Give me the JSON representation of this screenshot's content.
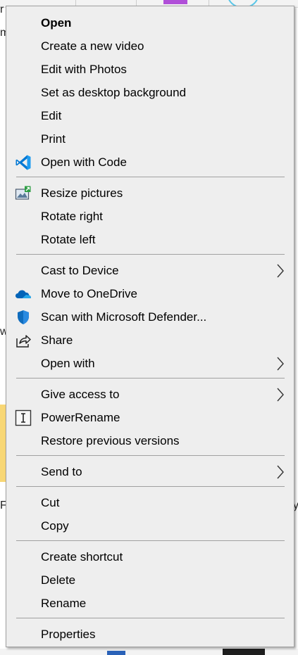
{
  "background": {
    "left_fragments": [
      "r",
      "m",
      "w",
      "F"
    ],
    "right_fragments": [
      "y."
    ]
  },
  "context_menu": {
    "items": [
      {
        "id": "open",
        "label": "Open",
        "icon": "",
        "bold": true,
        "submenu": false
      },
      {
        "id": "create-video",
        "label": "Create a new video",
        "icon": "",
        "bold": false,
        "submenu": false
      },
      {
        "id": "edit-photos",
        "label": "Edit with Photos",
        "icon": "",
        "bold": false,
        "submenu": false
      },
      {
        "id": "set-background",
        "label": "Set as desktop background",
        "icon": "",
        "bold": false,
        "submenu": false
      },
      {
        "id": "edit",
        "label": "Edit",
        "icon": "",
        "bold": false,
        "submenu": false
      },
      {
        "id": "print",
        "label": "Print",
        "icon": "",
        "bold": false,
        "submenu": false
      },
      {
        "id": "open-code",
        "label": "Open with Code",
        "icon": "vscode-icon",
        "bold": false,
        "submenu": false
      },
      {
        "id": "resize-pictures",
        "label": "Resize pictures",
        "icon": "image-resizer-icon",
        "bold": false,
        "submenu": false
      },
      {
        "id": "rotate-right",
        "label": "Rotate right",
        "icon": "",
        "bold": false,
        "submenu": false
      },
      {
        "id": "rotate-left",
        "label": "Rotate left",
        "icon": "",
        "bold": false,
        "submenu": false
      },
      {
        "id": "cast-device",
        "label": "Cast to Device",
        "icon": "",
        "bold": false,
        "submenu": true
      },
      {
        "id": "move-onedrive",
        "label": "Move to OneDrive",
        "icon": "onedrive-cloud-icon",
        "bold": false,
        "submenu": false
      },
      {
        "id": "scan-defender",
        "label": "Scan with Microsoft Defender...",
        "icon": "defender-shield-icon",
        "bold": false,
        "submenu": false
      },
      {
        "id": "share",
        "label": "Share",
        "icon": "share-icon",
        "bold": false,
        "submenu": false
      },
      {
        "id": "open-with",
        "label": "Open with",
        "icon": "",
        "bold": false,
        "submenu": true
      },
      {
        "id": "give-access",
        "label": "Give access to",
        "icon": "",
        "bold": false,
        "submenu": true
      },
      {
        "id": "power-rename",
        "label": "PowerRename",
        "icon": "powerrename-icon",
        "bold": false,
        "submenu": false
      },
      {
        "id": "restore-versions",
        "label": "Restore previous versions",
        "icon": "",
        "bold": false,
        "submenu": false
      },
      {
        "id": "send-to",
        "label": "Send to",
        "icon": "",
        "bold": false,
        "submenu": true
      },
      {
        "id": "cut",
        "label": "Cut",
        "icon": "",
        "bold": false,
        "submenu": false
      },
      {
        "id": "copy",
        "label": "Copy",
        "icon": "",
        "bold": false,
        "submenu": false
      },
      {
        "id": "create-shortcut",
        "label": "Create shortcut",
        "icon": "",
        "bold": false,
        "submenu": false
      },
      {
        "id": "delete",
        "label": "Delete",
        "icon": "",
        "bold": false,
        "submenu": false
      },
      {
        "id": "rename",
        "label": "Rename",
        "icon": "",
        "bold": false,
        "submenu": false
      },
      {
        "id": "properties",
        "label": "Properties",
        "icon": "",
        "bold": false,
        "submenu": false
      }
    ]
  },
  "colors": {
    "menu_background": "#eeeeee",
    "separator": "#a0a0a0",
    "vscode_blue": "#0078d4",
    "onedrive_blue": "#0364b8",
    "defender_blue": "#0f6cbd"
  }
}
